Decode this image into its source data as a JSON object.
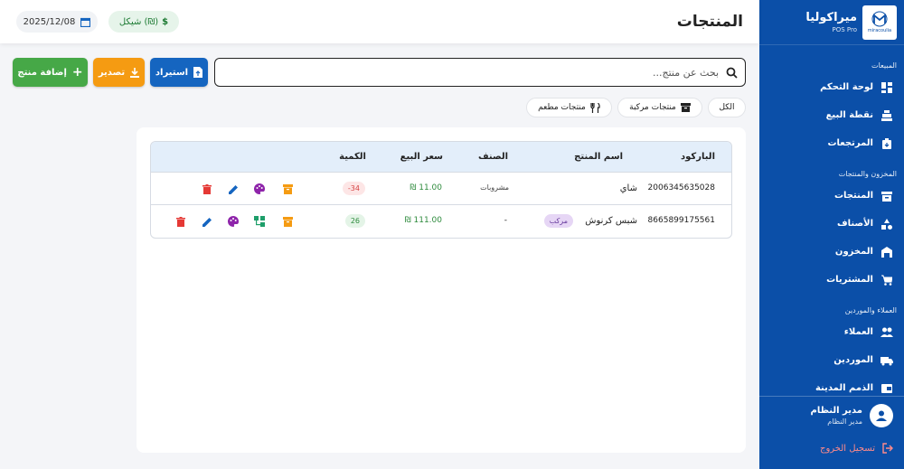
{
  "app": {
    "brand_name": "ميراكوليا",
    "brand_sub": "POS Pro",
    "logo_text": "miracoulia"
  },
  "header": {
    "title": "المنتجات",
    "date": "2025/12/08",
    "currency": "شيكل (₪)"
  },
  "sidebar": {
    "sections": [
      {
        "title": "المبيعات",
        "items": [
          {
            "label": "لوحة التحكم",
            "icon": "dashboard-icon"
          },
          {
            "label": "نقطة البيع",
            "icon": "cash-register-icon"
          },
          {
            "label": "المرتجعات",
            "icon": "returns-icon"
          }
        ]
      },
      {
        "title": "المخزون والمنتجات",
        "items": [
          {
            "label": "المنتجات",
            "icon": "box-icon"
          },
          {
            "label": "الأصناف",
            "icon": "categories-icon"
          },
          {
            "label": "المخزون",
            "icon": "warehouse-icon"
          },
          {
            "label": "المشتريات",
            "icon": "cart-icon"
          }
        ]
      },
      {
        "title": "العملاء والموردين",
        "items": [
          {
            "label": "العملاء",
            "icon": "people-icon"
          },
          {
            "label": "الموردين",
            "icon": "truck-icon"
          },
          {
            "label": "الذمم المدينة",
            "icon": "wallet-icon"
          }
        ]
      }
    ],
    "user": {
      "name": "مدير النظام",
      "role": "مدير النظام"
    },
    "logout": "تسجيل الخروج"
  },
  "toolbar": {
    "search_placeholder": "بحث عن منتج...",
    "import_label": "استيراد",
    "export_label": "تصدير",
    "add_label": "إضافة منتج"
  },
  "filters": {
    "all": "الكل",
    "composite": "منتجات مركبة",
    "restaurant": "منتجات مطعم"
  },
  "table": {
    "columns": [
      "الباركود",
      "اسم المنتج",
      "الصنف",
      "سعر البيع",
      "الكمية"
    ],
    "rows": [
      {
        "barcode": "2006345635028",
        "name": "شاي",
        "tag": "",
        "category": "مشروبات",
        "price": "₪ 11.00",
        "qty": "-34",
        "qty_status": "negative"
      },
      {
        "barcode": "8665899175561",
        "name": "شبس كرنوش",
        "tag": "مركب",
        "category": "-",
        "price": "₪ 111.00",
        "qty": "26",
        "qty_status": "positive"
      }
    ]
  },
  "colors": {
    "sidebar": "#0b4fa8",
    "import": "#1565c0",
    "export": "#f59b12",
    "add": "#46a847",
    "delete": "#e53935",
    "edit": "#1565c0",
    "palette": "#8e24aa",
    "archive": "#f59b12",
    "composite": "#1e9e6a"
  }
}
